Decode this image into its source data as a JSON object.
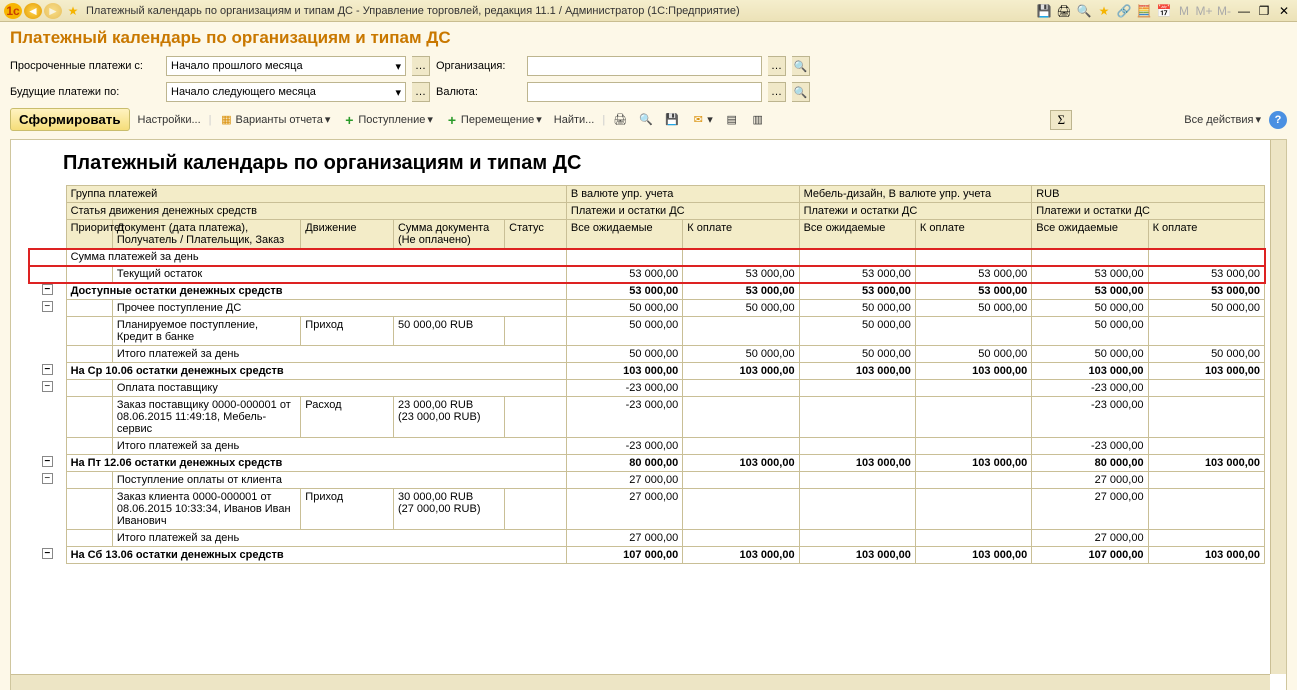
{
  "window": {
    "title": "Платежный календарь по организациям и типам ДС - Управление торговлей, редакция 11.1 / Администратор  (1С:Предприятие)"
  },
  "heading": "Платежный календарь по организациям и типам ДС",
  "filters": {
    "overdue_label": "Просроченные платежи с:",
    "overdue_value": "Начало прошлого месяца",
    "future_label": "Будущие платежи по:",
    "future_value": "Начало следующего месяца",
    "org_label": "Организация:",
    "org_value": "",
    "currency_label": "Валюта:",
    "currency_value": ""
  },
  "toolbar": {
    "generate": "Сформировать",
    "settings": "Настройки...",
    "variants": "Варианты отчета",
    "income": "Поступление",
    "move": "Перемещение",
    "find": "Найти...",
    "all_actions": "Все действия"
  },
  "report": {
    "title": "Платежный календарь по организациям и типам ДС",
    "h_group": "Группа платежей",
    "h_curr1": "В валюте упр. учета",
    "h_curr2": "Мебель-дизайн, В валюте упр. учета",
    "h_curr3": "RUB",
    "h_article": "Статья движения денежных средств",
    "h_payrem1": "Платежи и остатки ДС",
    "h_payrem2": "Платежи и остатки ДС",
    "h_payrem3": "Платежи и остатки ДС",
    "h_priority": "Приоритет",
    "h_doc": "Документ (дата платежа), Получатель / Плательщик, Заказ",
    "h_mov": "Движение",
    "h_sum": "Сумма документа (Не оплачено)",
    "h_status": "Статус",
    "h_all": "Все ожидаемые",
    "h_pay": "К оплате"
  },
  "rows": {
    "r1_name": "Сумма платежей за день",
    "r2_name": "Текущий остаток",
    "r2_v": "53 000,00",
    "r3_name": "Доступные остатки денежных средств",
    "r3_v": "53 000,00",
    "r4_name": "Прочее поступление ДС",
    "r4_v": "50 000,00",
    "r5_doc": "Планируемое поступление, Кредит в банке",
    "r5_mov": "Приход",
    "r5_sum": "50 000,00 RUB",
    "r5_v": "50 000,00",
    "r6_name": "Итого платежей за день",
    "r6_v": "50 000,00",
    "r7_name": "На Ср 10.06 остатки денежных средств",
    "r7_v": "103 000,00",
    "r8_name": "Оплата поставщику",
    "r8_v": "-23 000,00",
    "r9_doc": "Заказ поставщику 0000-000001 от 08.06.2015 11:49:18, Мебель-сервис",
    "r9_mov": "Расход",
    "r9_sum1": "23 000,00 RUB",
    "r9_sum2": "(23 000,00 RUB)",
    "r9_v": "-23 000,00",
    "r10_name": "Итого платежей за день",
    "r10_v": "-23 000,00",
    "r11_name": "На Пт 12.06 остатки денежных средств",
    "r11_v1": "80 000,00",
    "r11_v2": "103 000,00",
    "r12_name": "Поступление оплаты от клиента",
    "r12_v": "27 000,00",
    "r13_doc": "Заказ клиента 0000-000001 от 08.06.2015 10:33:34, Иванов Иван Иванович",
    "r13_mov": "Приход",
    "r13_sum1": "30 000,00 RUB",
    "r13_sum2": "(27 000,00 RUB)",
    "r13_v": "27 000,00",
    "r14_name": "Итого платежей за день",
    "r14_v": "27 000,00",
    "r15_name": "На Сб 13.06 остатки денежных средств",
    "r15_v1": "107 000,00",
    "r15_v2": "103 000,00"
  }
}
